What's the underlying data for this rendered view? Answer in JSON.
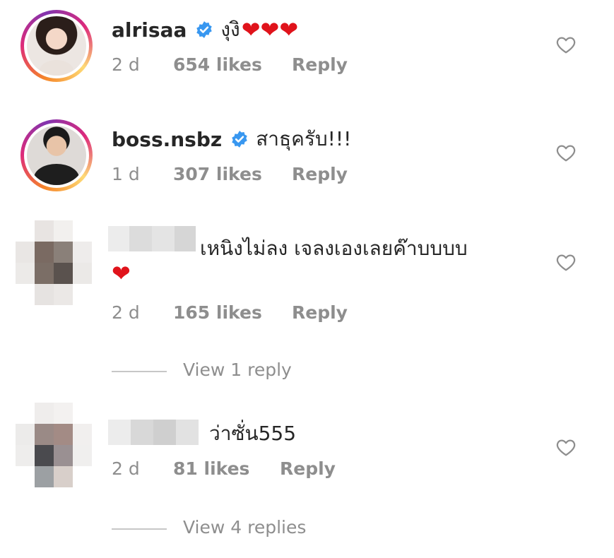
{
  "comments": [
    {
      "username": "alrisaa",
      "verified": true,
      "text": "งุงิ",
      "emoji": "❤❤❤",
      "time": "2 d",
      "likes": "654 likes",
      "reply": "Reply"
    },
    {
      "username": "boss.nsbz",
      "verified": true,
      "text": "สาธุครับ!!!",
      "time": "1 d",
      "likes": "307 likes",
      "reply": "Reply"
    },
    {
      "username": "",
      "verified": false,
      "text": "เหนิงไม่ลง เจลงเองเลยค๊าบบบบ",
      "emoji": "❤",
      "time": "2 d",
      "likes": "165 likes",
      "reply": "Reply",
      "view_replies": "View 1 reply"
    },
    {
      "username": "",
      "verified": false,
      "text": "ว่าซั่น555",
      "time": "2 d",
      "likes": "81 likes",
      "reply": "Reply",
      "view_replies": "View 4 replies"
    }
  ],
  "colors": {
    "verified_badge": "#3897f0",
    "meta_text": "#8e8e8e",
    "heart_emoji": "#e0131b",
    "icon_stroke": "#8e8e8e"
  },
  "icons": {
    "like": "heart-outline-icon",
    "verified": "verified-badge-icon"
  }
}
